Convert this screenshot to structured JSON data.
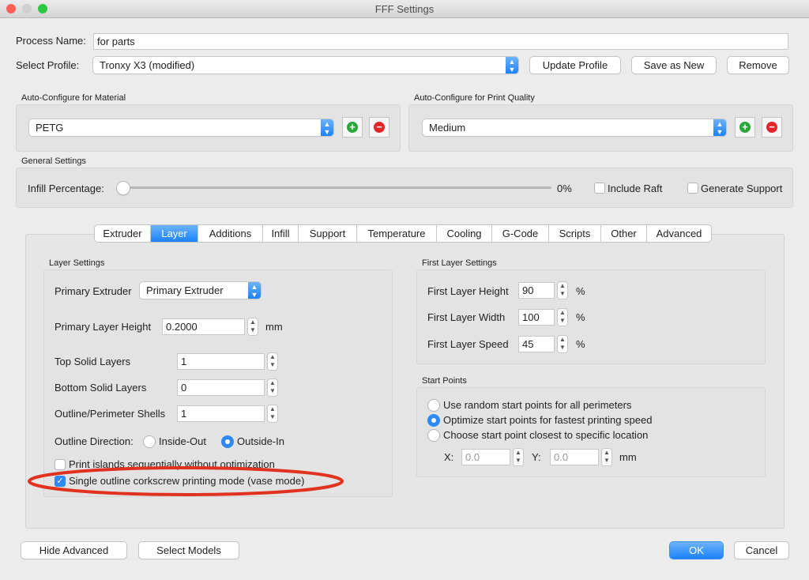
{
  "window": {
    "title": "FFF Settings"
  },
  "process": {
    "label": "Process Name:",
    "value": "for parts"
  },
  "profile": {
    "label": "Select Profile:",
    "value": "Tronxy X3 (modified)",
    "update": "Update Profile",
    "save_new": "Save as New",
    "remove": "Remove"
  },
  "material": {
    "title": "Auto-Configure for Material",
    "value": "PETG"
  },
  "quality": {
    "title": "Auto-Configure for Print Quality",
    "value": "Medium"
  },
  "general": {
    "title": "General Settings",
    "infill_label": "Infill Percentage:",
    "infill_value": "0%",
    "infill_fraction": 0,
    "include_raft": "Include Raft",
    "generate_support": "Generate Support"
  },
  "tabs": [
    "Extruder",
    "Layer",
    "Additions",
    "Infill",
    "Support",
    "Temperature",
    "Cooling",
    "G-Code",
    "Scripts",
    "Other",
    "Advanced"
  ],
  "layer": {
    "title": "Layer Settings",
    "primary_extruder_label": "Primary Extruder",
    "primary_extruder_value": "Primary Extruder",
    "layer_height_label": "Primary Layer Height",
    "layer_height_value": "0.2000",
    "mm": "mm",
    "top_label": "Top Solid Layers",
    "top_value": "1",
    "bottom_label": "Bottom Solid Layers",
    "bottom_value": "0",
    "shells_label": "Outline/Perimeter Shells",
    "shells_value": "1",
    "direction_label": "Outline Direction:",
    "inside_out": "Inside-Out",
    "outside_in": "Outside-In",
    "islands": "Print islands sequentially without optimization",
    "vase": "Single outline corkscrew printing mode (vase mode)"
  },
  "first_layer": {
    "title": "First Layer Settings",
    "height_label": "First Layer Height",
    "height_value": "90",
    "width_label": "First Layer Width",
    "width_value": "100",
    "speed_label": "First Layer Speed",
    "speed_value": "45",
    "pct": "%"
  },
  "start": {
    "title": "Start Points",
    "opt1": "Use random start points for all perimeters",
    "opt2": "Optimize start points for fastest printing speed",
    "opt3": "Choose start point closest to specific location",
    "x_label": "X:",
    "x_value": "0.0",
    "y_label": "Y:",
    "y_value": "0.0",
    "mm": "mm"
  },
  "footer": {
    "hide_advanced": "Hide Advanced",
    "select_models": "Select Models",
    "ok": "OK",
    "cancel": "Cancel"
  },
  "colors": {
    "accent": "#1a82fb",
    "annotation": "#e0321e"
  }
}
